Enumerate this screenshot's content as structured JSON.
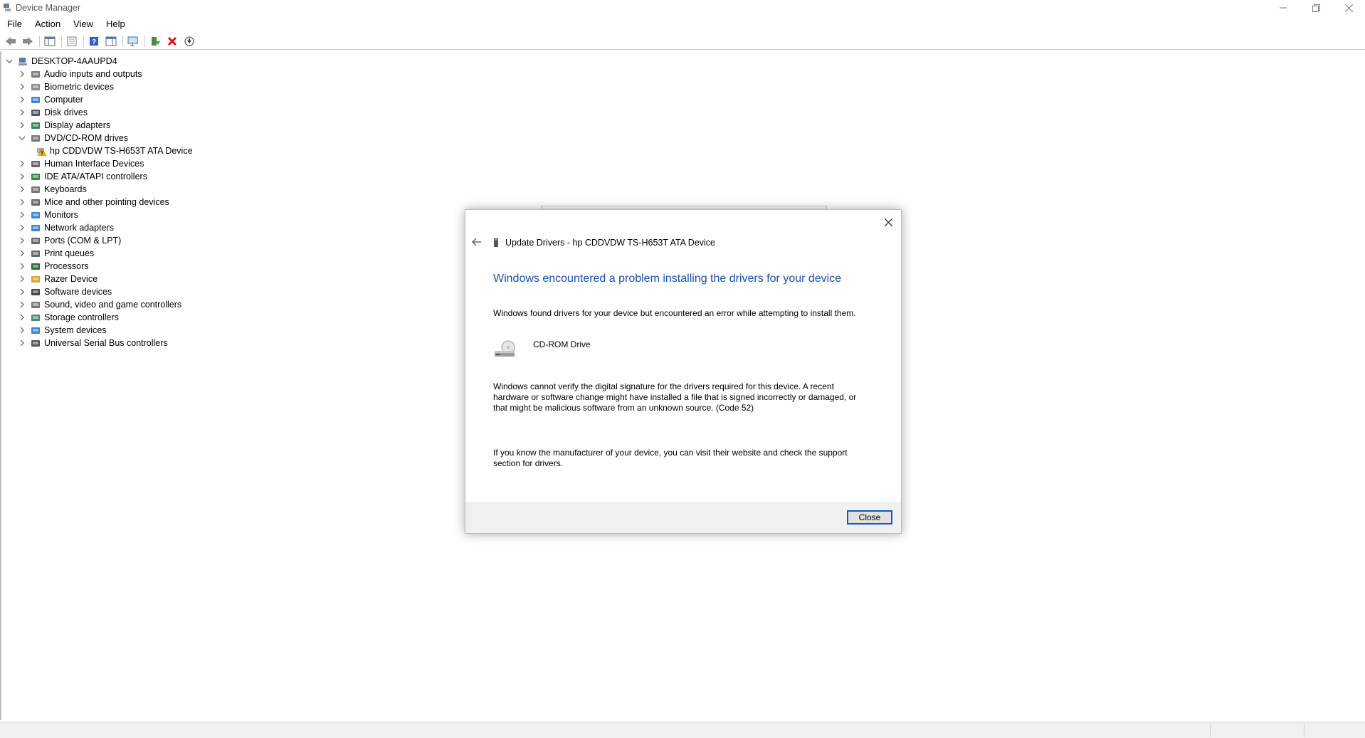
{
  "window": {
    "title": "Device Manager"
  },
  "menu": [
    "File",
    "Action",
    "View",
    "Help"
  ],
  "toolbar_icons": [
    "back-icon",
    "forward-icon",
    "show-hide-console-tree-icon",
    "properties-icon",
    "help-icon",
    "action-pane-icon",
    "scan-hardware-icon",
    "update-driver-icon",
    "uninstall-icon",
    "download-icon"
  ],
  "tree": {
    "root": "DESKTOP-4AAUPD4",
    "items": [
      {
        "label": "Audio inputs and outputs",
        "icon": "speaker-icon",
        "expanded": false
      },
      {
        "label": "Biometric devices",
        "icon": "fingerprint-icon",
        "expanded": false
      },
      {
        "label": "Computer",
        "icon": "computer-icon",
        "expanded": false
      },
      {
        "label": "Disk drives",
        "icon": "disk-drive-icon",
        "expanded": false
      },
      {
        "label": "Display adapters",
        "icon": "display-adapter-icon",
        "expanded": false
      },
      {
        "label": "DVD/CD-ROM drives",
        "icon": "cd-drive-icon",
        "expanded": true
      },
      {
        "label": "hp CDDVDW TS-H653T ATA Device",
        "icon": "cd-drive-warning-icon",
        "child": true
      },
      {
        "label": "Human Interface Devices",
        "icon": "hid-icon",
        "expanded": false
      },
      {
        "label": "IDE ATA/ATAPI controllers",
        "icon": "ide-controller-icon",
        "expanded": false
      },
      {
        "label": "Keyboards",
        "icon": "keyboard-icon",
        "expanded": false
      },
      {
        "label": "Mice and other pointing devices",
        "icon": "mouse-icon",
        "expanded": false
      },
      {
        "label": "Monitors",
        "icon": "monitor-icon",
        "expanded": false
      },
      {
        "label": "Network adapters",
        "icon": "network-icon",
        "expanded": false
      },
      {
        "label": "Ports (COM & LPT)",
        "icon": "port-icon",
        "expanded": false
      },
      {
        "label": "Print queues",
        "icon": "printer-icon",
        "expanded": false
      },
      {
        "label": "Processors",
        "icon": "processor-icon",
        "expanded": false
      },
      {
        "label": "Razer Device",
        "icon": "razer-icon",
        "expanded": false
      },
      {
        "label": "Software devices",
        "icon": "software-device-icon",
        "expanded": false
      },
      {
        "label": "Sound, video and game controllers",
        "icon": "sound-icon",
        "expanded": false
      },
      {
        "label": "Storage controllers",
        "icon": "storage-controller-icon",
        "expanded": false
      },
      {
        "label": "System devices",
        "icon": "system-device-icon",
        "expanded": false
      },
      {
        "label": "Universal Serial Bus controllers",
        "icon": "usb-icon",
        "expanded": false
      }
    ]
  },
  "dialog": {
    "title": "Update Drivers - hp CDDVDW TS-H653T ATA Device",
    "heading": "Windows encountered a problem installing the drivers for your device",
    "p1": "Windows found drivers for your device but encountered an error while attempting to install them.",
    "device_name": "CD-ROM Drive",
    "p2": "Windows cannot verify the digital signature for the drivers required for this device. A recent hardware or software change might have installed a file that is signed incorrectly or damaged, or that might be malicious software from an unknown source. (Code 52)",
    "p3": "If you know the manufacturer of your device, you can visit their website and check the support section for drivers.",
    "close_button": "Close"
  },
  "colors": {
    "heading_blue": "#1a4fa8",
    "button_border": "#0a5ac8"
  }
}
